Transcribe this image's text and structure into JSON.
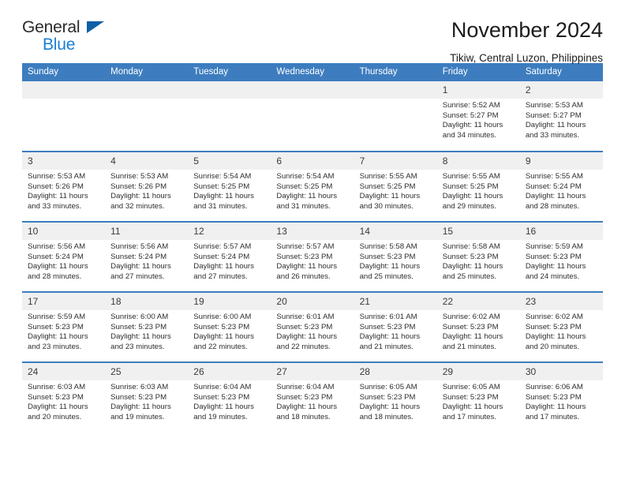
{
  "brand": {
    "name_top": "General",
    "name_bottom": "Blue",
    "triangle_icon": "logo-triangle-icon",
    "color_top": "#2b2b2b",
    "color_bottom": "#1a7fd4"
  },
  "header": {
    "title": "November 2024",
    "subtitle": "Tikiw, Central Luzon, Philippines"
  },
  "theme": {
    "header_blue": "#3d7dbf",
    "daynum_gray": "#f0f0f0",
    "text": "#2e2e2e"
  },
  "weekdays": [
    "Sunday",
    "Monday",
    "Tuesday",
    "Wednesday",
    "Thursday",
    "Friday",
    "Saturday"
  ],
  "weeks": [
    [
      {
        "day": "",
        "empty": true
      },
      {
        "day": "",
        "empty": true
      },
      {
        "day": "",
        "empty": true
      },
      {
        "day": "",
        "empty": true
      },
      {
        "day": "",
        "empty": true
      },
      {
        "day": "1",
        "sunrise": "Sunrise: 5:52 AM",
        "sunset": "Sunset: 5:27 PM",
        "daylight": "Daylight: 11 hours and 34 minutes."
      },
      {
        "day": "2",
        "sunrise": "Sunrise: 5:53 AM",
        "sunset": "Sunset: 5:27 PM",
        "daylight": "Daylight: 11 hours and 33 minutes."
      }
    ],
    [
      {
        "day": "3",
        "sunrise": "Sunrise: 5:53 AM",
        "sunset": "Sunset: 5:26 PM",
        "daylight": "Daylight: 11 hours and 33 minutes."
      },
      {
        "day": "4",
        "sunrise": "Sunrise: 5:53 AM",
        "sunset": "Sunset: 5:26 PM",
        "daylight": "Daylight: 11 hours and 32 minutes."
      },
      {
        "day": "5",
        "sunrise": "Sunrise: 5:54 AM",
        "sunset": "Sunset: 5:25 PM",
        "daylight": "Daylight: 11 hours and 31 minutes."
      },
      {
        "day": "6",
        "sunrise": "Sunrise: 5:54 AM",
        "sunset": "Sunset: 5:25 PM",
        "daylight": "Daylight: 11 hours and 31 minutes."
      },
      {
        "day": "7",
        "sunrise": "Sunrise: 5:55 AM",
        "sunset": "Sunset: 5:25 PM",
        "daylight": "Daylight: 11 hours and 30 minutes."
      },
      {
        "day": "8",
        "sunrise": "Sunrise: 5:55 AM",
        "sunset": "Sunset: 5:25 PM",
        "daylight": "Daylight: 11 hours and 29 minutes."
      },
      {
        "day": "9",
        "sunrise": "Sunrise: 5:55 AM",
        "sunset": "Sunset: 5:24 PM",
        "daylight": "Daylight: 11 hours and 28 minutes."
      }
    ],
    [
      {
        "day": "10",
        "sunrise": "Sunrise: 5:56 AM",
        "sunset": "Sunset: 5:24 PM",
        "daylight": "Daylight: 11 hours and 28 minutes."
      },
      {
        "day": "11",
        "sunrise": "Sunrise: 5:56 AM",
        "sunset": "Sunset: 5:24 PM",
        "daylight": "Daylight: 11 hours and 27 minutes."
      },
      {
        "day": "12",
        "sunrise": "Sunrise: 5:57 AM",
        "sunset": "Sunset: 5:24 PM",
        "daylight": "Daylight: 11 hours and 27 minutes."
      },
      {
        "day": "13",
        "sunrise": "Sunrise: 5:57 AM",
        "sunset": "Sunset: 5:23 PM",
        "daylight": "Daylight: 11 hours and 26 minutes."
      },
      {
        "day": "14",
        "sunrise": "Sunrise: 5:58 AM",
        "sunset": "Sunset: 5:23 PM",
        "daylight": "Daylight: 11 hours and 25 minutes."
      },
      {
        "day": "15",
        "sunrise": "Sunrise: 5:58 AM",
        "sunset": "Sunset: 5:23 PM",
        "daylight": "Daylight: 11 hours and 25 minutes."
      },
      {
        "day": "16",
        "sunrise": "Sunrise: 5:59 AM",
        "sunset": "Sunset: 5:23 PM",
        "daylight": "Daylight: 11 hours and 24 minutes."
      }
    ],
    [
      {
        "day": "17",
        "sunrise": "Sunrise: 5:59 AM",
        "sunset": "Sunset: 5:23 PM",
        "daylight": "Daylight: 11 hours and 23 minutes."
      },
      {
        "day": "18",
        "sunrise": "Sunrise: 6:00 AM",
        "sunset": "Sunset: 5:23 PM",
        "daylight": "Daylight: 11 hours and 23 minutes."
      },
      {
        "day": "19",
        "sunrise": "Sunrise: 6:00 AM",
        "sunset": "Sunset: 5:23 PM",
        "daylight": "Daylight: 11 hours and 22 minutes."
      },
      {
        "day": "20",
        "sunrise": "Sunrise: 6:01 AM",
        "sunset": "Sunset: 5:23 PM",
        "daylight": "Daylight: 11 hours and 22 minutes."
      },
      {
        "day": "21",
        "sunrise": "Sunrise: 6:01 AM",
        "sunset": "Sunset: 5:23 PM",
        "daylight": "Daylight: 11 hours and 21 minutes."
      },
      {
        "day": "22",
        "sunrise": "Sunrise: 6:02 AM",
        "sunset": "Sunset: 5:23 PM",
        "daylight": "Daylight: 11 hours and 21 minutes."
      },
      {
        "day": "23",
        "sunrise": "Sunrise: 6:02 AM",
        "sunset": "Sunset: 5:23 PM",
        "daylight": "Daylight: 11 hours and 20 minutes."
      }
    ],
    [
      {
        "day": "24",
        "sunrise": "Sunrise: 6:03 AM",
        "sunset": "Sunset: 5:23 PM",
        "daylight": "Daylight: 11 hours and 20 minutes."
      },
      {
        "day": "25",
        "sunrise": "Sunrise: 6:03 AM",
        "sunset": "Sunset: 5:23 PM",
        "daylight": "Daylight: 11 hours and 19 minutes."
      },
      {
        "day": "26",
        "sunrise": "Sunrise: 6:04 AM",
        "sunset": "Sunset: 5:23 PM",
        "daylight": "Daylight: 11 hours and 19 minutes."
      },
      {
        "day": "27",
        "sunrise": "Sunrise: 6:04 AM",
        "sunset": "Sunset: 5:23 PM",
        "daylight": "Daylight: 11 hours and 18 minutes."
      },
      {
        "day": "28",
        "sunrise": "Sunrise: 6:05 AM",
        "sunset": "Sunset: 5:23 PM",
        "daylight": "Daylight: 11 hours and 18 minutes."
      },
      {
        "day": "29",
        "sunrise": "Sunrise: 6:05 AM",
        "sunset": "Sunset: 5:23 PM",
        "daylight": "Daylight: 11 hours and 17 minutes."
      },
      {
        "day": "30",
        "sunrise": "Sunrise: 6:06 AM",
        "sunset": "Sunset: 5:23 PM",
        "daylight": "Daylight: 11 hours and 17 minutes."
      }
    ]
  ]
}
